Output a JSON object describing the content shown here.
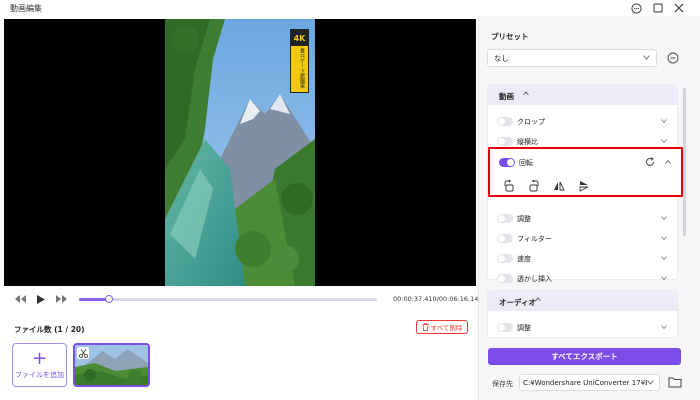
{
  "window": {
    "title": "動画編集"
  },
  "player": {
    "time": "00:00:37.410/00:06:16.140",
    "progress": 0.1,
    "badge": {
      "label": "4K",
      "brand": "夏ロゲーツ旅園東"
    }
  },
  "files": {
    "count_label": "ファイル数 (1 / 20)",
    "delete_all": "すべて削除",
    "add_file": "ファイルを追加"
  },
  "preset": {
    "label": "プリセット",
    "value": "なし"
  },
  "video_panel": {
    "title": "動画",
    "rows": [
      {
        "label": "クロップ",
        "on": false
      },
      {
        "label": "縦横比",
        "on": false
      },
      {
        "label": "回転",
        "on": true
      },
      {
        "label": "調整",
        "on": false
      },
      {
        "label": "フィルター",
        "on": false
      },
      {
        "label": "速度",
        "on": false
      },
      {
        "label": "透かし挿入",
        "on": false
      }
    ]
  },
  "audio_panel": {
    "title": "オーディオ",
    "rows": [
      {
        "label": "調整",
        "on": false
      }
    ]
  },
  "export": {
    "button": "すべてエクスポート",
    "save_label": "保存先",
    "save_path": "C:¥Wondershare UniConverter 17¥E"
  },
  "colors": {
    "accent": "#7b4de8",
    "highlight": "#e00010",
    "danger": "#e33333"
  },
  "icons": [
    "chat-icon",
    "maximize-icon",
    "close-icon",
    "rewind-icon",
    "play-icon",
    "fast-forward-icon",
    "trash-icon",
    "plus-icon",
    "scissors-icon",
    "more-icon",
    "chevron-down-icon",
    "chevron-up-icon",
    "reset-icon",
    "rotate-left-icon",
    "rotate-right-icon",
    "flip-horizontal-icon",
    "flip-vertical-icon",
    "folder-icon"
  ]
}
